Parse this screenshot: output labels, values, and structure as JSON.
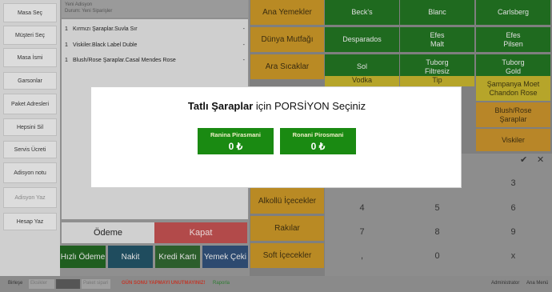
{
  "sidebar": {
    "items": [
      {
        "label": "Masa Seç"
      },
      {
        "label": "Müşteri Seç"
      },
      {
        "label": "Masa İsmi"
      },
      {
        "label": "Garsonlar"
      },
      {
        "label": "Paket Adresleri"
      },
      {
        "label": "Hepsini Sil"
      },
      {
        "label": "Servis Ücreti"
      },
      {
        "label": "Adisyon notu"
      },
      {
        "label": "Adisyon Yaz"
      },
      {
        "label": "Hesap Yaz"
      }
    ]
  },
  "order": {
    "header_line1": "Yeni Adisyon",
    "header_line2": "Durum: Yeni Siparişler",
    "rows": [
      {
        "qty": "1",
        "name": "Kırmızı Şaraplar.Suvla Sır",
        "dash": "-"
      },
      {
        "qty": "1",
        "name": "Viskiler.Black Label Duble",
        "dash": "-"
      },
      {
        "qty": "1",
        "name": "Blush/Rose Şaraplar.Casal Mendes Rose",
        "dash": "-"
      }
    ],
    "odeme_label": "Ödeme",
    "kapat_label": "Kapat",
    "pay_buttons": [
      {
        "label": "Hızlı Ödeme"
      },
      {
        "label": "Nakit"
      },
      {
        "label": "Kredi Kartı"
      },
      {
        "label": "Yemek Çeki"
      }
    ]
  },
  "categories": [
    {
      "label": "Ana Yemekler"
    },
    {
      "label": "Dünya Mutfağı"
    },
    {
      "label": "Ara Sıcaklar"
    },
    {
      "label": "Alkollü İçecekler"
    },
    {
      "label": "Rakılar"
    },
    {
      "label": "Soft İçecekler"
    }
  ],
  "products": [
    {
      "label": "Beck's",
      "sub": ""
    },
    {
      "label": "Blanc",
      "sub": ""
    },
    {
      "label": "Carlsberg",
      "sub": ""
    },
    {
      "label": "Desparados",
      "sub": ""
    },
    {
      "label": "Efes",
      "sub": "Malt"
    },
    {
      "label": "Efes",
      "sub": "Pilsen"
    },
    {
      "label": "Sol",
      "sub": ""
    },
    {
      "label": "Tuborg",
      "sub": "Filtresiz"
    },
    {
      "label": "Tuborg",
      "sub": "Gold"
    },
    {
      "label": "Vodka",
      "sub": ""
    },
    {
      "label": "Tip",
      "sub": ""
    },
    {
      "label": "Şampanya Moet",
      "sub": "Chandon Rose"
    },
    {
      "label": "Blush/Rose",
      "sub": "Şaraplar"
    },
    {
      "label": "Viskiler",
      "sub": ""
    }
  ],
  "keypad": {
    "keys": [
      "3",
      "4",
      "5",
      "6",
      "7",
      "8",
      "9",
      ",",
      "0",
      "x"
    ]
  },
  "modal": {
    "title_bold": "Tatlı Şaraplar",
    "title_rest": " için PORSİYON Seçiniz",
    "options": [
      {
        "name": "Ranina Pirasmani",
        "price": "0 ₺"
      },
      {
        "name": "Ronani Pirosmani",
        "price": "0 ₺"
      }
    ]
  },
  "footer": {
    "left_label": "Birleşe",
    "input1": "Eksikler",
    "input2": "Paket sipari",
    "warning": "GÜN SONU YAPMAYI UNUTMAYINIZ!",
    "report": "Raporla",
    "user": "Administrator",
    "menu": "Ana Menü"
  },
  "colors": {
    "modal_button": "#1a8a12",
    "warning": "#c0392b",
    "category": "#b98a24",
    "product_green": "#1f6a1f"
  }
}
